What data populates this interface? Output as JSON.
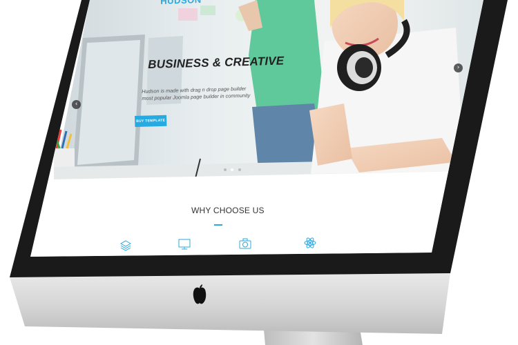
{
  "site": {
    "brand": "HUDSON"
  },
  "hero": {
    "title": "BUSINESS & CREATIVE",
    "subtitle_line1": "Hudson is made with drag n drop page builder",
    "subtitle_line2": "most popular Joomla page builder in community",
    "button_label": "BUY TEMPLATE",
    "prev_arrow": "‹",
    "next_arrow": "›",
    "slide_count": 3,
    "active_slide": 1
  },
  "features": {
    "title": "WHY CHOOSE US",
    "icons": [
      "layers-icon",
      "monitor-icon",
      "camera-icon",
      "atom-icon"
    ]
  },
  "colors": {
    "accent": "#27a9e1",
    "bezel": "#1a1a1a",
    "aluminum": "#d7d7d7"
  }
}
